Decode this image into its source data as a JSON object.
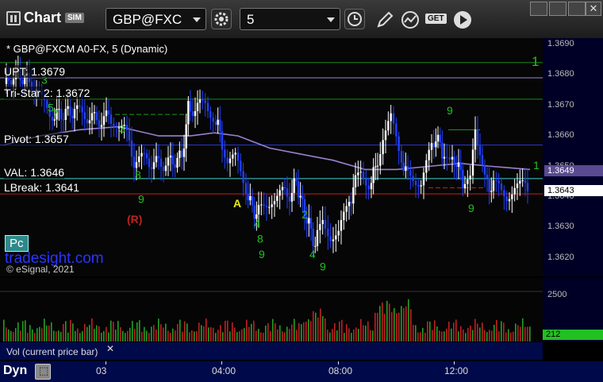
{
  "toolbar": {
    "chart_label": "Chart",
    "sim_badge": "SIM",
    "symbol": "GBP@FXC",
    "interval": "5",
    "get_label": "GET",
    "icons": [
      "settings-icon",
      "clock-icon",
      "pencil-icon",
      "compare-icon",
      "get-icon",
      "play-icon"
    ]
  },
  "window_controls": [
    "restore",
    "minimize",
    "maximize",
    "close"
  ],
  "chart": {
    "header": "* GBP@FXCM A0-FX, 5 (Dynamic)",
    "levels": [
      {
        "label": "UPT: 1.3679",
        "price": 1.3679,
        "color": "#9a88cc"
      },
      {
        "label": "Tri-Star 2: 1.3672",
        "price": 1.3672,
        "color": "#1a8a1a"
      },
      {
        "label": "Pivot: 1.3657",
        "price": 1.3657,
        "color": "#2a3acc"
      },
      {
        "label": "VAL: 1.3646",
        "price": 1.3646,
        "color": "#40d0d0"
      },
      {
        "label": "LBreak: 1.3641",
        "price": 1.3641,
        "color": "#c02020"
      }
    ],
    "top_line_price": 1.3684,
    "markers": {
      "a": "A",
      "r": "(R)",
      "one_top": "1",
      "one_right": "1"
    },
    "watermark": "tradesight.com",
    "copyright": "© eSignal, 2021",
    "pc_button": "Pc",
    "last_price": "1.3643",
    "ma_price": "1.3649",
    "seq_labels": [
      {
        "t": "3",
        "x": 52,
        "p": 1.3677
      },
      {
        "t": "5",
        "x": 60,
        "p": 1.3668
      },
      {
        "t": "7",
        "x": 66,
        "p": 1.3666
      },
      {
        "t": "3",
        "x": 150,
        "p": 1.3661
      },
      {
        "t": "8",
        "x": 170,
        "p": 1.3646
      },
      {
        "t": "9",
        "x": 174,
        "p": 1.3638
      },
      {
        "t": "4",
        "x": 320,
        "p": 1.363
      },
      {
        "t": "8",
        "x": 324,
        "p": 1.3625
      },
      {
        "t": "9",
        "x": 326,
        "p": 1.362
      },
      {
        "t": "4",
        "x": 390,
        "p": 1.362
      },
      {
        "t": "9",
        "x": 403,
        "p": 1.3616
      },
      {
        "t": "9",
        "x": 563,
        "p": 1.3667
      },
      {
        "t": "9",
        "x": 590,
        "p": 1.3635
      },
      {
        "t": "2",
        "x": 380,
        "p": 1.3633
      }
    ]
  },
  "chart_data": {
    "type": "candlestick",
    "symbol": "GBP@FXCM",
    "interval": "5",
    "ylim": [
      1.3614,
      1.3692
    ],
    "y_ticks": [
      "1.3690",
      "1.3680",
      "1.3670",
      "1.3660",
      "1.3650",
      "1.3640",
      "1.3630",
      "1.3620"
    ],
    "x_ticks": [
      {
        "label": "03",
        "x": 133
      },
      {
        "label": "04:00",
        "x": 279
      },
      {
        "label": "08:00",
        "x": 426
      },
      {
        "label": "12:00",
        "x": 572
      }
    ],
    "close_path": [
      [
        8,
        1.3677
      ],
      [
        20,
        1.368
      ],
      [
        34,
        1.3679
      ],
      [
        46,
        1.3676
      ],
      [
        56,
        1.3671
      ],
      [
        66,
        1.3667
      ],
      [
        80,
        1.3667
      ],
      [
        94,
        1.3668
      ],
      [
        110,
        1.3667
      ],
      [
        125,
        1.3665
      ],
      [
        140,
        1.3666
      ],
      [
        150,
        1.3665
      ],
      [
        160,
        1.3662
      ],
      [
        172,
        1.3652
      ],
      [
        185,
        1.3652
      ],
      [
        200,
        1.3651
      ],
      [
        215,
        1.3651
      ],
      [
        232,
        1.3653
      ],
      [
        240,
        1.3669
      ],
      [
        252,
        1.3669
      ],
      [
        262,
        1.3671
      ],
      [
        272,
        1.3667
      ],
      [
        280,
        1.3661
      ],
      [
        290,
        1.3652
      ],
      [
        300,
        1.3652
      ],
      [
        310,
        1.3645
      ],
      [
        318,
        1.3638
      ],
      [
        326,
        1.3634
      ],
      [
        336,
        1.3637
      ],
      [
        346,
        1.364
      ],
      [
        356,
        1.3641
      ],
      [
        368,
        1.3641
      ],
      [
        376,
        1.3645
      ],
      [
        384,
        1.3637
      ],
      [
        392,
        1.3631
      ],
      [
        400,
        1.3624
      ],
      [
        410,
        1.3632
      ],
      [
        420,
        1.3628
      ],
      [
        430,
        1.3628
      ],
      [
        440,
        1.3635
      ],
      [
        448,
        1.3643
      ],
      [
        458,
        1.3648
      ],
      [
        468,
        1.3645
      ],
      [
        476,
        1.3649
      ],
      [
        486,
        1.366
      ],
      [
        496,
        1.3665
      ],
      [
        506,
        1.3655
      ],
      [
        514,
        1.3648
      ],
      [
        524,
        1.3647
      ],
      [
        534,
        1.3645
      ],
      [
        544,
        1.3653
      ],
      [
        552,
        1.366
      ],
      [
        560,
        1.3655
      ],
      [
        570,
        1.365
      ],
      [
        578,
        1.3652
      ],
      [
        586,
        1.3645
      ],
      [
        596,
        1.3645
      ],
      [
        602,
        1.3661
      ],
      [
        608,
        1.3656
      ],
      [
        614,
        1.3645
      ],
      [
        622,
        1.3643
      ],
      [
        632,
        1.3643
      ],
      [
        642,
        1.3641
      ],
      [
        652,
        1.3643
      ],
      [
        662,
        1.3643
      ],
      [
        668,
        1.3643
      ]
    ],
    "ma_path": [
      [
        5,
        1.3657
      ],
      [
        50,
        1.366
      ],
      [
        100,
        1.3662
      ],
      [
        150,
        1.3663
      ],
      [
        200,
        1.366
      ],
      [
        240,
        1.366
      ],
      [
        270,
        1.3661
      ],
      [
        300,
        1.366
      ],
      [
        340,
        1.3656
      ],
      [
        380,
        1.3654
      ],
      [
        420,
        1.3652
      ],
      [
        460,
        1.3649
      ],
      [
        500,
        1.3649
      ],
      [
        540,
        1.365
      ],
      [
        580,
        1.3651
      ],
      [
        620,
        1.365
      ],
      [
        668,
        1.3649
      ]
    ],
    "volume": {
      "ylim": [
        0,
        3000
      ],
      "y_ticks": [
        "2500",
        "0"
      ],
      "last_volume": "212",
      "label": "Vol (current price bar)"
    }
  },
  "bottom": {
    "label": "Dyn"
  }
}
